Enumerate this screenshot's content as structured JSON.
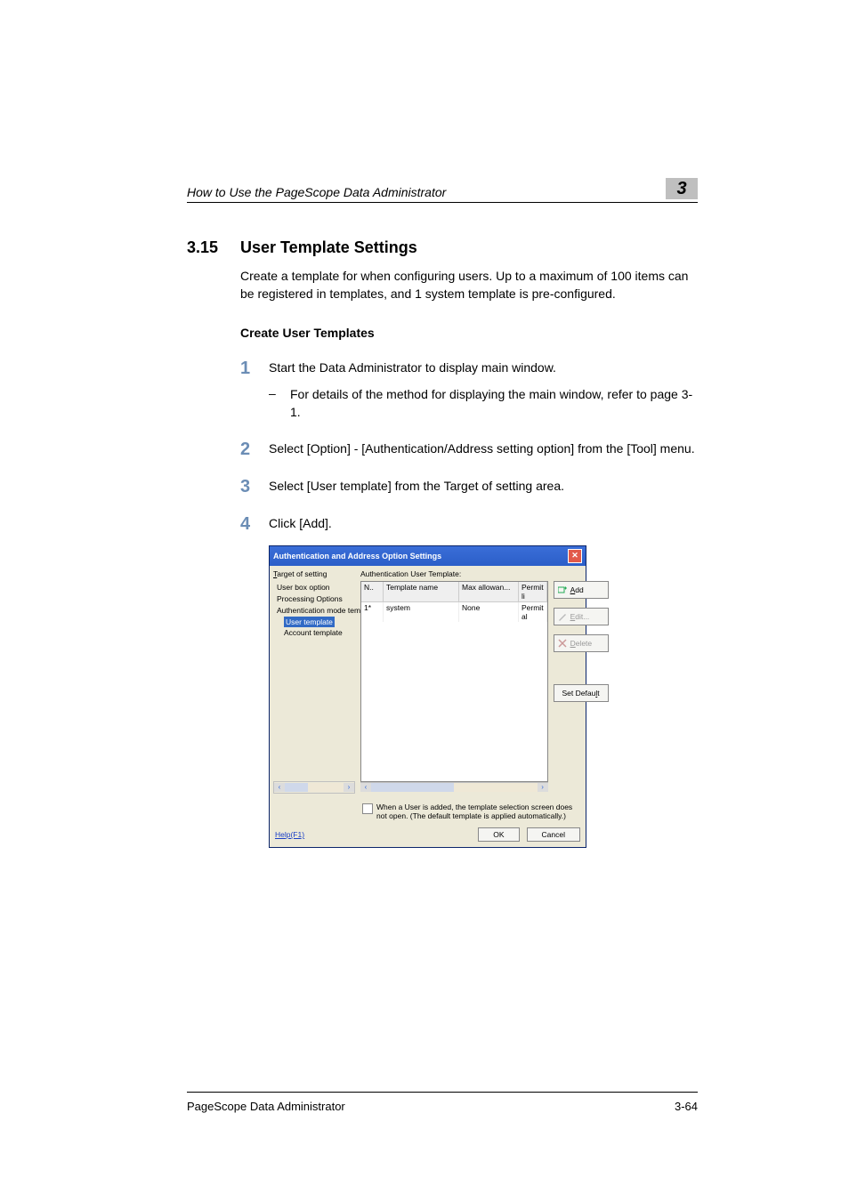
{
  "header": {
    "running": "How to Use the PageScope Data Administrator",
    "chapter": "3"
  },
  "section": {
    "num": "3.15",
    "title": "User Template Settings"
  },
  "intro": "Create a template for when configuring users. Up to a maximum of 100 items can be registered in templates, and 1 system template is pre-configured.",
  "subtitle": "Create User Templates",
  "steps": [
    {
      "n": "1",
      "text": "Start the Data Administrator to display main window.",
      "sub": "For details of the method for displaying the main window, refer to page 3-1."
    },
    {
      "n": "2",
      "text": "Select [Option] - [Authentication/Address setting option] from the [Tool] menu."
    },
    {
      "n": "3",
      "text": "Select [User template] from the Target of setting area."
    },
    {
      "n": "4",
      "text": "Click [Add]."
    }
  ],
  "dialog": {
    "title": "Authentication and Address Option Settings",
    "left_label_pre": "T",
    "left_label_rest": "arget of setting",
    "tree": {
      "items": [
        "User box option",
        "Processing Options",
        "Authentication mode tem"
      ],
      "selected": "User template",
      "after": [
        "Account template"
      ]
    },
    "right_title": "Authentication User Template:",
    "columns": {
      "n": "N..",
      "tn": "Template name",
      "ma": "Max allowan...",
      "p": "Permit li"
    },
    "row": {
      "n": "1*",
      "tn": "system",
      "ma": "None",
      "p": "Permit al"
    },
    "buttons": {
      "add_u": "A",
      "add_r": "dd",
      "edit_u": "E",
      "edit_r": "dit...",
      "delete_u": "D",
      "delete_r": "elete",
      "setdefault_pre": "Set Defau",
      "setdefault_u": "l",
      "setdefault_post": "t"
    },
    "checkbox_pre": "W",
    "checkbox_text": "hen a User is added, the template selection screen does not open. (The default template is applied automatically.)",
    "help": "Help(F1)",
    "ok": "OK",
    "cancel": "Cancel"
  },
  "footer": {
    "left": "PageScope Data Administrator",
    "right": "3-64"
  }
}
